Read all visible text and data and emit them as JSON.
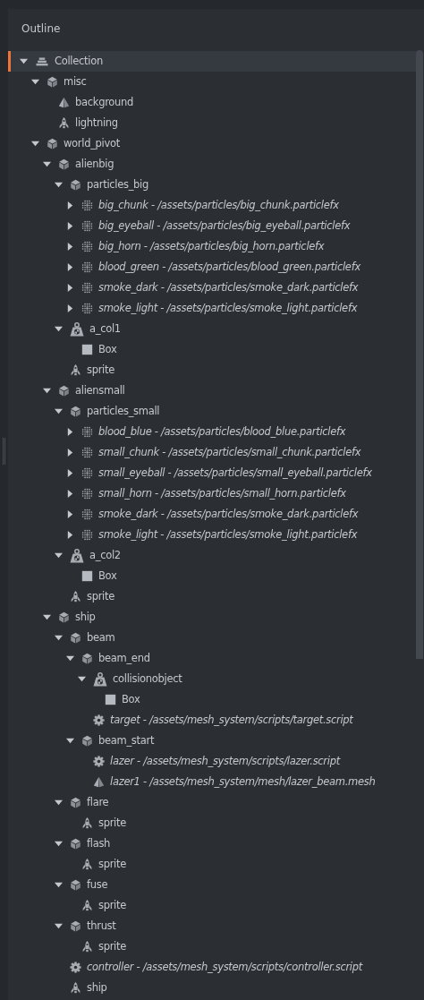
{
  "panel": {
    "title": "Outline"
  },
  "tree": [
    {
      "label": "Collection",
      "kind": "collection",
      "selected": true,
      "expanded": true,
      "children": [
        {
          "label": "misc",
          "kind": "gameobject",
          "selected": false,
          "expanded": true,
          "children": [
            {
              "label": "background",
              "kind": "model",
              "selected": false
            },
            {
              "label": "lightning",
              "kind": "sprite",
              "selected": false
            }
          ]
        },
        {
          "label": "world_pivot",
          "kind": "gameobject",
          "selected": false,
          "expanded": true,
          "children": [
            {
              "label": "alienbig",
              "kind": "gameobject",
              "selected": false,
              "expanded": true,
              "children": [
                {
                  "label": "particles_big",
                  "kind": "gameobject",
                  "selected": false,
                  "expanded": true,
                  "children": [
                    {
                      "label": "big_chunk - /assets/particles/big_chunk.particlefx",
                      "kind": "particlefx",
                      "reference": true,
                      "selected": false,
                      "expanded": false
                    },
                    {
                      "label": "big_eyeball - /assets/particles/big_eyeball.particlefx",
                      "kind": "particlefx",
                      "reference": true,
                      "selected": false,
                      "expanded": false
                    },
                    {
                      "label": "big_horn - /assets/particles/big_horn.particlefx",
                      "kind": "particlefx",
                      "reference": true,
                      "selected": false,
                      "expanded": false
                    },
                    {
                      "label": "blood_green - /assets/particles/blood_green.particlefx",
                      "kind": "particlefx",
                      "reference": true,
                      "selected": false,
                      "expanded": false
                    },
                    {
                      "label": "smoke_dark - /assets/particles/smoke_dark.particlefx",
                      "kind": "particlefx",
                      "reference": true,
                      "selected": false,
                      "expanded": false
                    },
                    {
                      "label": "smoke_light - /assets/particles/smoke_light.particlefx",
                      "kind": "particlefx",
                      "reference": true,
                      "selected": false,
                      "expanded": false
                    }
                  ]
                },
                {
                  "label": "a_col1",
                  "kind": "collision",
                  "selected": false,
                  "expanded": true,
                  "children": [
                    {
                      "label": "Box",
                      "kind": "box",
                      "selected": false
                    }
                  ]
                },
                {
                  "label": "sprite",
                  "kind": "sprite",
                  "selected": false
                }
              ]
            },
            {
              "label": "aliensmall",
              "kind": "gameobject",
              "selected": false,
              "expanded": true,
              "children": [
                {
                  "label": "particles_small",
                  "kind": "gameobject",
                  "selected": false,
                  "expanded": true,
                  "children": [
                    {
                      "label": "blood_blue - /assets/particles/blood_blue.particlefx",
                      "kind": "particlefx",
                      "reference": true,
                      "selected": false,
                      "expanded": false
                    },
                    {
                      "label": "small_chunk - /assets/particles/small_chunk.particlefx",
                      "kind": "particlefx",
                      "reference": true,
                      "selected": false,
                      "expanded": false
                    },
                    {
                      "label": "small_eyeball - /assets/particles/small_eyeball.particlefx",
                      "kind": "particlefx",
                      "reference": true,
                      "selected": false,
                      "expanded": false
                    },
                    {
                      "label": "small_horn - /assets/particles/small_horn.particlefx",
                      "kind": "particlefx",
                      "reference": true,
                      "selected": false,
                      "expanded": false
                    },
                    {
                      "label": "smoke_dark - /assets/particles/smoke_dark.particlefx",
                      "kind": "particlefx",
                      "reference": true,
                      "selected": false,
                      "expanded": false
                    },
                    {
                      "label": "smoke_light - /assets/particles/smoke_light.particlefx",
                      "kind": "particlefx",
                      "reference": true,
                      "selected": false,
                      "expanded": false
                    }
                  ]
                },
                {
                  "label": "a_col2",
                  "kind": "collision",
                  "selected": false,
                  "expanded": true,
                  "children": [
                    {
                      "label": "Box",
                      "kind": "box",
                      "selected": false
                    }
                  ]
                },
                {
                  "label": "sprite",
                  "kind": "sprite",
                  "selected": false
                }
              ]
            },
            {
              "label": "ship",
              "kind": "gameobject",
              "selected": false,
              "expanded": true,
              "children": [
                {
                  "label": "beam",
                  "kind": "gameobject",
                  "selected": false,
                  "expanded": true,
                  "children": [
                    {
                      "label": "beam_end",
                      "kind": "gameobject",
                      "selected": false,
                      "expanded": true,
                      "children": [
                        {
                          "label": "collisionobject",
                          "kind": "collision",
                          "selected": false,
                          "expanded": true,
                          "children": [
                            {
                              "label": "Box",
                              "kind": "box",
                              "selected": false
                            }
                          ]
                        },
                        {
                          "label": "target - /assets/mesh_system/scripts/target.script",
                          "kind": "script",
                          "reference": true,
                          "selected": false
                        }
                      ]
                    },
                    {
                      "label": "beam_start",
                      "kind": "gameobject",
                      "selected": false,
                      "expanded": true,
                      "children": [
                        {
                          "label": "lazer - /assets/mesh_system/scripts/lazer.script",
                          "kind": "script",
                          "reference": true,
                          "selected": false
                        },
                        {
                          "label": "lazer1 - /assets/mesh_system/mesh/lazer_beam.mesh",
                          "kind": "model",
                          "reference": true,
                          "selected": false
                        }
                      ]
                    }
                  ]
                },
                {
                  "label": "flare",
                  "kind": "gameobject",
                  "selected": false,
                  "expanded": true,
                  "children": [
                    {
                      "label": "sprite",
                      "kind": "sprite",
                      "selected": false
                    }
                  ]
                },
                {
                  "label": "flash",
                  "kind": "gameobject",
                  "selected": false,
                  "expanded": true,
                  "children": [
                    {
                      "label": "sprite",
                      "kind": "sprite",
                      "selected": false
                    }
                  ]
                },
                {
                  "label": "fuse",
                  "kind": "gameobject",
                  "selected": false,
                  "expanded": true,
                  "children": [
                    {
                      "label": "sprite",
                      "kind": "sprite",
                      "selected": false
                    }
                  ]
                },
                {
                  "label": "thrust",
                  "kind": "gameobject",
                  "selected": false,
                  "expanded": true,
                  "children": [
                    {
                      "label": "sprite",
                      "kind": "sprite",
                      "selected": false
                    }
                  ]
                },
                {
                  "label": "controller - /assets/mesh_system/scripts/controller.script",
                  "kind": "script",
                  "reference": true,
                  "selected": false
                },
                {
                  "label": "ship",
                  "kind": "sprite",
                  "selected": false
                }
              ]
            }
          ]
        }
      ]
    }
  ]
}
